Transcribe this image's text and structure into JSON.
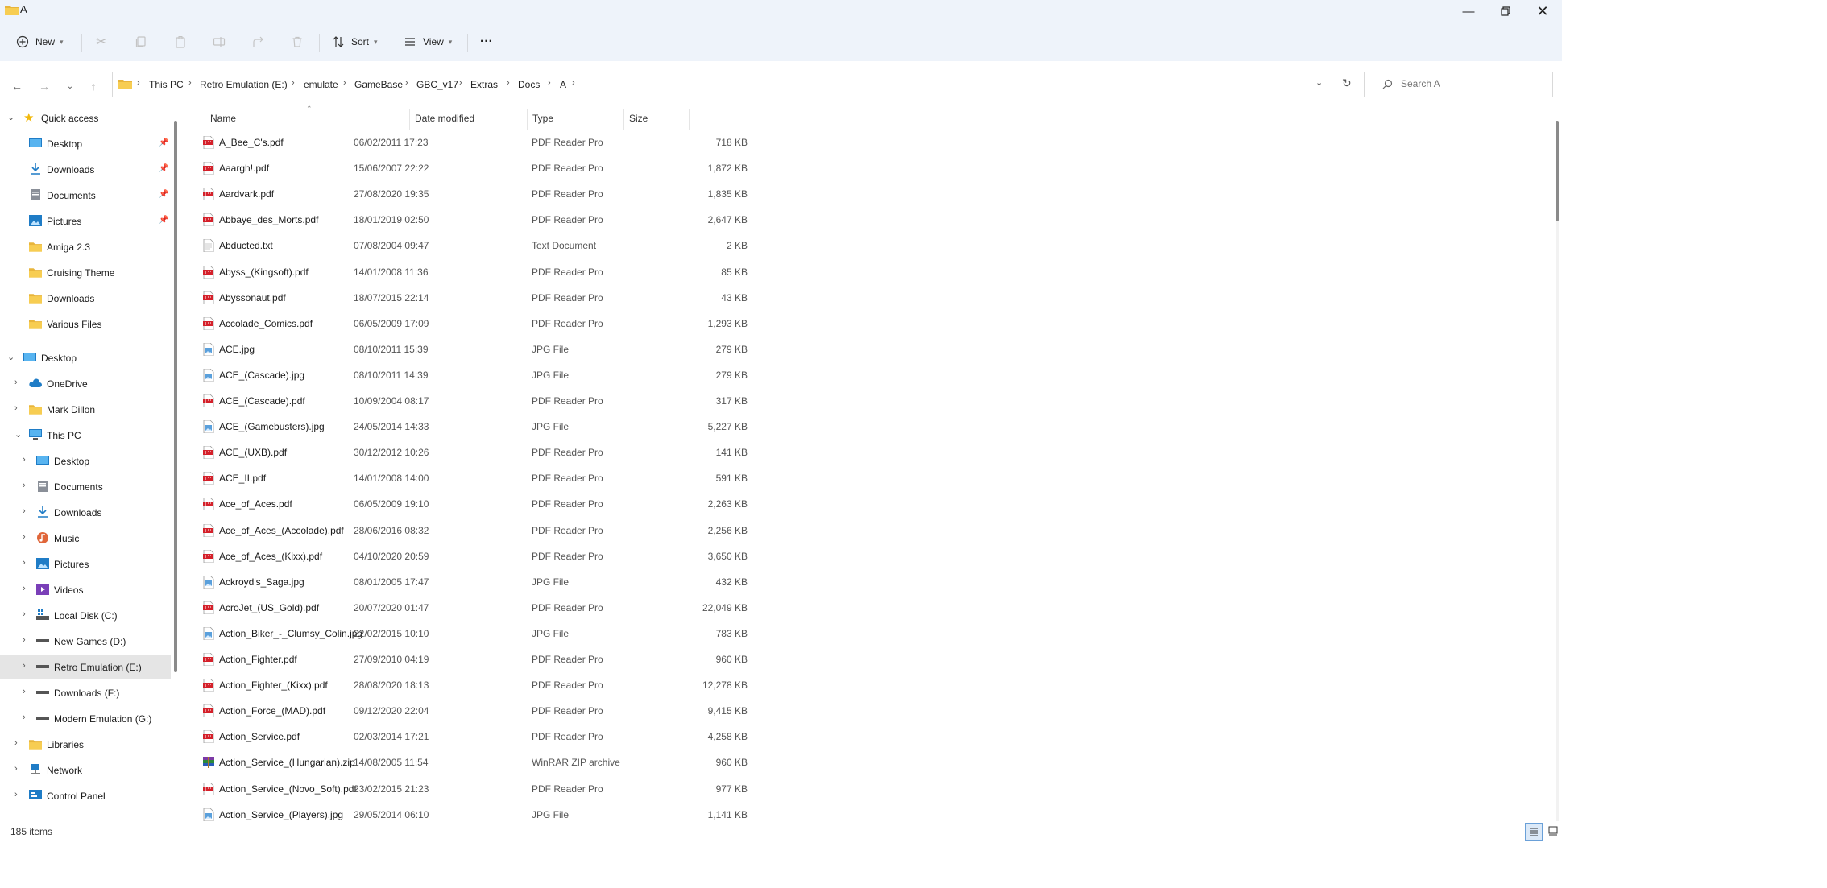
{
  "window": {
    "title": "A"
  },
  "toolbar": {
    "new_label": "New",
    "sort_label": "Sort",
    "view_label": "View",
    "more_label": "···"
  },
  "address": {
    "crumbs": [
      "This PC",
      "Retro Emulation (E:)",
      "emulate",
      "GameBase",
      "GBC_v17",
      "Extras",
      "Docs",
      "A"
    ]
  },
  "search": {
    "placeholder": "Search A"
  },
  "nav": {
    "quick_access": "Quick access",
    "quick_items": [
      {
        "label": "Desktop",
        "pinned": true
      },
      {
        "label": "Downloads",
        "pinned": true
      },
      {
        "label": "Documents",
        "pinned": true
      },
      {
        "label": "Pictures",
        "pinned": true
      },
      {
        "label": "Amiga 2.3"
      },
      {
        "label": "Cruising Theme"
      },
      {
        "label": "Downloads"
      },
      {
        "label": "Various Files"
      }
    ],
    "desktop": "Desktop",
    "onedrive": "OneDrive",
    "user": "Mark Dillon",
    "this_pc": "This PC",
    "pc_items": [
      "Desktop",
      "Documents",
      "Downloads",
      "Music",
      "Pictures",
      "Videos",
      "Local Disk (C:)",
      "New Games (D:)",
      "Retro Emulation (E:)",
      "Downloads (F:)",
      "Modern Emulation (G:)"
    ],
    "libraries": "Libraries",
    "network": "Network",
    "control_panel": "Control Panel"
  },
  "columns": {
    "name": "Name",
    "date": "Date modified",
    "type": "Type",
    "size": "Size"
  },
  "files": [
    {
      "name": "A_Bee_C's.pdf",
      "date": "06/02/2011 17:23",
      "type": "PDF Reader Pro",
      "size": "718 KB",
      "kind": "pdf"
    },
    {
      "name": "Aaargh!.pdf",
      "date": "15/06/2007 22:22",
      "type": "PDF Reader Pro",
      "size": "1,872 KB",
      "kind": "pdf"
    },
    {
      "name": "Aardvark.pdf",
      "date": "27/08/2020 19:35",
      "type": "PDF Reader Pro",
      "size": "1,835 KB",
      "kind": "pdf"
    },
    {
      "name": "Abbaye_des_Morts.pdf",
      "date": "18/01/2019 02:50",
      "type": "PDF Reader Pro",
      "size": "2,647 KB",
      "kind": "pdf"
    },
    {
      "name": "Abducted.txt",
      "date": "07/08/2004 09:47",
      "type": "Text Document",
      "size": "2 KB",
      "kind": "txt"
    },
    {
      "name": "Abyss_(Kingsoft).pdf",
      "date": "14/01/2008 11:36",
      "type": "PDF Reader Pro",
      "size": "85 KB",
      "kind": "pdf"
    },
    {
      "name": "Abyssonaut.pdf",
      "date": "18/07/2015 22:14",
      "type": "PDF Reader Pro",
      "size": "43 KB",
      "kind": "pdf"
    },
    {
      "name": "Accolade_Comics.pdf",
      "date": "06/05/2009 17:09",
      "type": "PDF Reader Pro",
      "size": "1,293 KB",
      "kind": "pdf"
    },
    {
      "name": "ACE.jpg",
      "date": "08/10/2011 15:39",
      "type": "JPG File",
      "size": "279 KB",
      "kind": "jpg"
    },
    {
      "name": "ACE_(Cascade).jpg",
      "date": "08/10/2011 14:39",
      "type": "JPG File",
      "size": "279 KB",
      "kind": "jpg"
    },
    {
      "name": "ACE_(Cascade).pdf",
      "date": "10/09/2004 08:17",
      "type": "PDF Reader Pro",
      "size": "317 KB",
      "kind": "pdf"
    },
    {
      "name": "ACE_(Gamebusters).jpg",
      "date": "24/05/2014 14:33",
      "type": "JPG File",
      "size": "5,227 KB",
      "kind": "jpg"
    },
    {
      "name": "ACE_(UXB).pdf",
      "date": "30/12/2012 10:26",
      "type": "PDF Reader Pro",
      "size": "141 KB",
      "kind": "pdf"
    },
    {
      "name": "ACE_II.pdf",
      "date": "14/01/2008 14:00",
      "type": "PDF Reader Pro",
      "size": "591 KB",
      "kind": "pdf"
    },
    {
      "name": "Ace_of_Aces.pdf",
      "date": "06/05/2009 19:10",
      "type": "PDF Reader Pro",
      "size": "2,263 KB",
      "kind": "pdf"
    },
    {
      "name": "Ace_of_Aces_(Accolade).pdf",
      "date": "28/06/2016 08:32",
      "type": "PDF Reader Pro",
      "size": "2,256 KB",
      "kind": "pdf"
    },
    {
      "name": "Ace_of_Aces_(Kixx).pdf",
      "date": "04/10/2020 20:59",
      "type": "PDF Reader Pro",
      "size": "3,650 KB",
      "kind": "pdf"
    },
    {
      "name": "Ackroyd's_Saga.jpg",
      "date": "08/01/2005 17:47",
      "type": "JPG File",
      "size": "432 KB",
      "kind": "jpg"
    },
    {
      "name": "AcroJet_(US_Gold).pdf",
      "date": "20/07/2020 01:47",
      "type": "PDF Reader Pro",
      "size": "22,049 KB",
      "kind": "pdf"
    },
    {
      "name": "Action_Biker_-_Clumsy_Colin.jpg",
      "date": "22/02/2015 10:10",
      "type": "JPG File",
      "size": "783 KB",
      "kind": "jpg"
    },
    {
      "name": "Action_Fighter.pdf",
      "date": "27/09/2010 04:19",
      "type": "PDF Reader Pro",
      "size": "960 KB",
      "kind": "pdf"
    },
    {
      "name": "Action_Fighter_(Kixx).pdf",
      "date": "28/08/2020 18:13",
      "type": "PDF Reader Pro",
      "size": "12,278 KB",
      "kind": "pdf"
    },
    {
      "name": "Action_Force_(MAD).pdf",
      "date": "09/12/2020 22:04",
      "type": "PDF Reader Pro",
      "size": "9,415 KB",
      "kind": "pdf"
    },
    {
      "name": "Action_Service.pdf",
      "date": "02/03/2014 17:21",
      "type": "PDF Reader Pro",
      "size": "4,258 KB",
      "kind": "pdf"
    },
    {
      "name": "Action_Service_(Hungarian).zip",
      "date": "14/08/2005 11:54",
      "type": "WinRAR ZIP archive",
      "size": "960 KB",
      "kind": "zip"
    },
    {
      "name": "Action_Service_(Novo_Soft).pdf",
      "date": "23/02/2015 21:23",
      "type": "PDF Reader Pro",
      "size": "977 KB",
      "kind": "pdf"
    },
    {
      "name": "Action_Service_(Players).jpg",
      "date": "29/05/2014 06:10",
      "type": "JPG File",
      "size": "1,141 KB",
      "kind": "jpg"
    }
  ],
  "status": {
    "count": "185 items"
  }
}
